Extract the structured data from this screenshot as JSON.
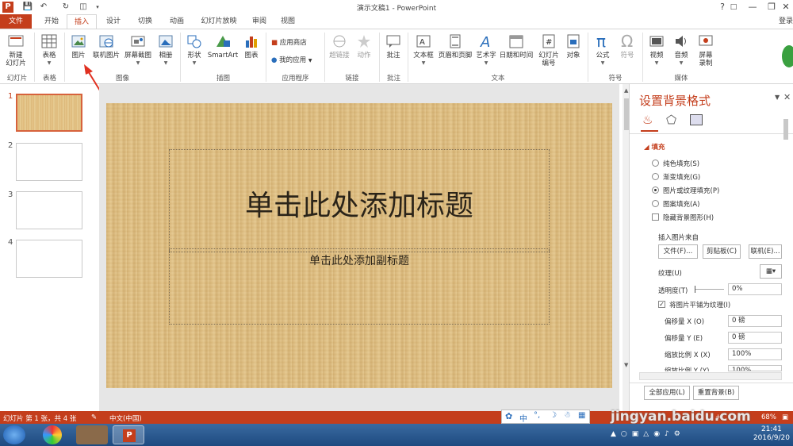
{
  "window": {
    "title": "演示文稿1 - PowerPoint",
    "login": "登录"
  },
  "tabs": [
    "文件",
    "开始",
    "插入",
    "设计",
    "切换",
    "动画",
    "幻灯片放映",
    "审阅",
    "视图"
  ],
  "ribbon": {
    "new_slide": "新建\n幻灯片",
    "table": "表格",
    "picture": "图片",
    "online_picture": "联机图片",
    "screenshot": "屏幕截图",
    "album": "相册",
    "shapes": "形状",
    "smartart": "SmartArt",
    "chart": "图表",
    "app_store": "应用商店",
    "my_apps": "我的应用",
    "hyperlink": "超链接",
    "action": "动作",
    "comment": "批注",
    "textbox": "文本框",
    "header_footer": "页眉和页脚",
    "wordart": "艺术字",
    "datetime": "日期和时间",
    "slide_number": "幻灯片\n编号",
    "object": "对象",
    "equation": "公式",
    "symbol": "符号",
    "video": "视频",
    "audio": "音频",
    "screen_recording": "屏幕\n录制",
    "groups": {
      "slides": "幻灯片",
      "tables": "表格",
      "images": "图像",
      "illustrations": "插图",
      "apps": "应用程序",
      "links": "链接",
      "comments": "批注",
      "text": "文本",
      "symbols": "符号",
      "media": "媒体"
    }
  },
  "thumbnails": [
    "1",
    "2",
    "3",
    "4"
  ],
  "slide": {
    "title": "单击此处添加标题",
    "subtitle": "单击此处添加副标题"
  },
  "pane": {
    "title": "设置背景格式",
    "section": "填充",
    "options": [
      "纯色填充(S)",
      "渐变填充(G)",
      "图片或纹理填充(P)",
      "图案填充(A)"
    ],
    "hide_bg": "隐藏背景图形(H)",
    "insert_from": "插入图片来自",
    "btn_file": "文件(F)...",
    "btn_clipboard": "剪贴板(C)",
    "btn_online": "联机(E)...",
    "texture": "纹理(U)",
    "transparency": "透明度(T)",
    "transparency_val": "0%",
    "tile": "将图片平铺为纹理(I)",
    "offset_x": "偏移量 X (O)",
    "offset_x_val": "0 磅",
    "offset_y": "偏移量 Y (E)",
    "offset_y_val": "0 磅",
    "scale_x": "缩放比例 X (X)",
    "scale_x_val": "100%",
    "scale_y": "缩放比例 Y (Y)",
    "scale_y_val": "100%",
    "apply_all": "全部应用(L)",
    "reset": "重置背景(B)"
  },
  "status": {
    "slide_info": "幻灯片 第 1 张，共 4 张",
    "lang": "中文(中国)",
    "zoom": "68%"
  },
  "taskbar": {
    "time": "21:41",
    "date": "2016/9/20"
  },
  "watermark": "jingyan.baidu.com"
}
